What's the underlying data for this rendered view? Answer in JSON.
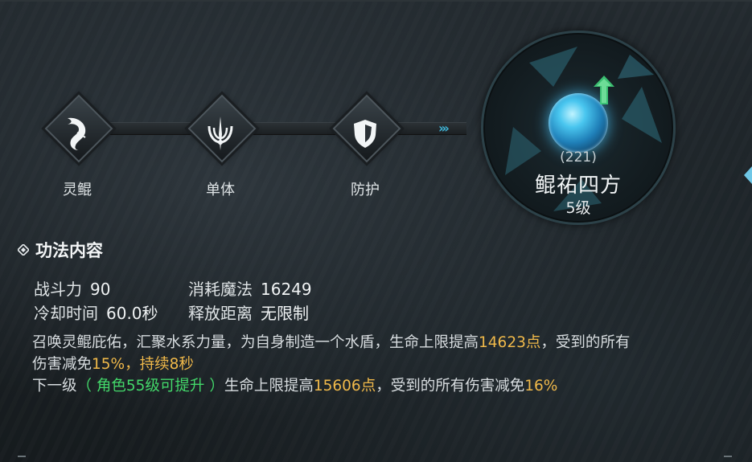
{
  "path_nodes": [
    {
      "label": "灵鲲",
      "icon": "whale-fin-icon"
    },
    {
      "label": "单体",
      "icon": "single-target-icon"
    },
    {
      "label": "防护",
      "icon": "shield-icon"
    }
  ],
  "chevrons": "›››",
  "skill": {
    "code": "(221)",
    "name": "鲲祐四方",
    "level": "5级",
    "upgrade_icon": "upgrade-arrow-icon"
  },
  "section_title": "功法内容",
  "stats": {
    "power_label": "战斗力",
    "power_value": "90",
    "mana_label": "消耗魔法",
    "mana_value": "16249",
    "cooldown_label": "冷却时间",
    "cooldown_value": "60.0秒",
    "range_label": "释放距离",
    "range_value": "无限制"
  },
  "description": {
    "line1_a": "召唤灵鲲庇佑，汇聚水系力量，为自身制造一个水盾，生命上限提高",
    "line1_hp": "14623点",
    "line1_b": "，受到的所有",
    "line2_a": "伤害减免",
    "line2_dr": "15%",
    "line2_b": "，持续8秒",
    "next_label": "下一级",
    "next_condition": "（ 角色55级可提升 ）",
    "next_a": "生命上限提高",
    "next_hp": "15606点",
    "next_b": "，受到的所有伤害减免",
    "next_dr": "16%"
  },
  "colors": {
    "gold": "#f0b94a",
    "green": "#43d86a",
    "accent": "#3fb4d6"
  }
}
